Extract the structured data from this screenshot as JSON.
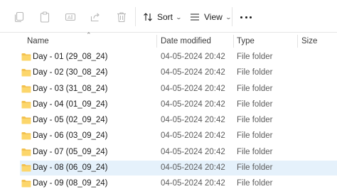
{
  "toolbar": {
    "icons": [
      "copy-icon",
      "paste-icon",
      "rename-icon",
      "share-icon",
      "delete-icon"
    ],
    "sort_label": "Sort",
    "view_label": "View",
    "more_icon": "more-icon"
  },
  "columns": {
    "name": "Name",
    "date": "Date modified",
    "type": "Type",
    "size": "Size",
    "sorted_by": "name"
  },
  "colors": {
    "folder": "#f3c14e",
    "selected_row": "#e5f1fb",
    "accent": "#0067c0"
  },
  "rows": [
    {
      "name": "Day - 01 (29_08_24)",
      "date": "04-05-2024 20:42",
      "type": "File folder",
      "size": ""
    },
    {
      "name": "Day - 02 (30_08_24)",
      "date": "04-05-2024 20:42",
      "type": "File folder",
      "size": ""
    },
    {
      "name": "Day - 03 (31_08_24)",
      "date": "04-05-2024 20:42",
      "type": "File folder",
      "size": ""
    },
    {
      "name": "Day - 04 (01_09_24)",
      "date": "04-05-2024 20:42",
      "type": "File folder",
      "size": ""
    },
    {
      "name": "Day - 05 (02_09_24)",
      "date": "04-05-2024 20:42",
      "type": "File folder",
      "size": ""
    },
    {
      "name": "Day - 06 (03_09_24)",
      "date": "04-05-2024 20:42",
      "type": "File folder",
      "size": ""
    },
    {
      "name": "Day - 07 (05_09_24)",
      "date": "04-05-2024 20:42",
      "type": "File folder",
      "size": ""
    },
    {
      "name": "Day - 08 (06_09_24)",
      "date": "04-05-2024 20:42",
      "type": "File folder",
      "size": "",
      "selected": true
    },
    {
      "name": "Day - 09 (08_09_24)",
      "date": "04-05-2024 20:42",
      "type": "File folder",
      "size": ""
    }
  ]
}
